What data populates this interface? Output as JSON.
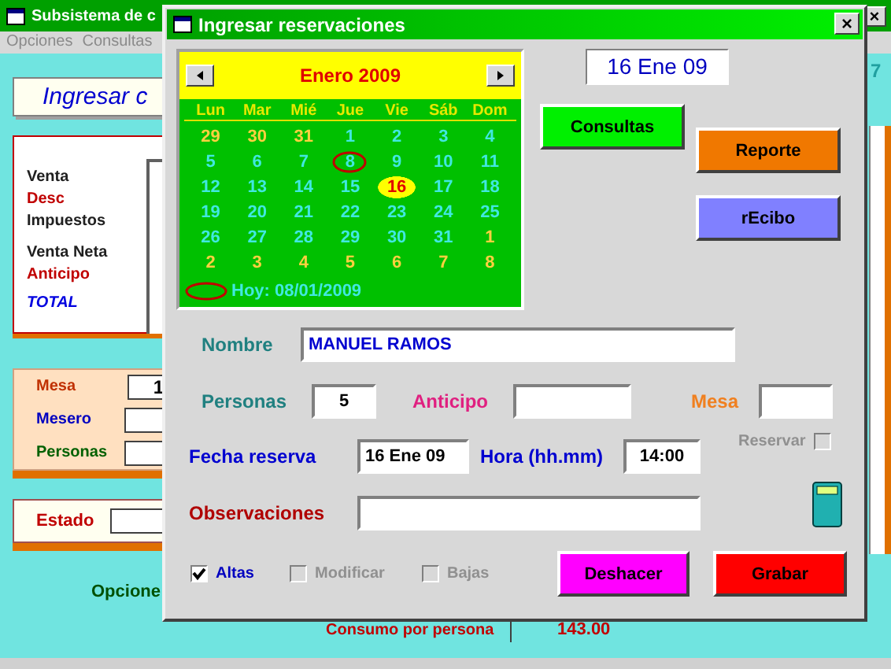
{
  "main_window": {
    "title": "Subsistema de c",
    "close_button": "×",
    "menu": [
      {
        "label": "Opciones",
        "disabled": true
      },
      {
        "label": "Consultas",
        "disabled": true
      }
    ],
    "header_field": {
      "value": "Ingresar c"
    },
    "right_text": "7",
    "totals": [
      {
        "label": "Venta",
        "color": "#202020"
      },
      {
        "label": "Desc",
        "color": "#c00000"
      },
      {
        "label": "Impuestos",
        "color": "#202020"
      },
      {
        "label": "Venta Neta",
        "color": "#202020"
      },
      {
        "label": "Anticipo",
        "color": "#c00000"
      },
      {
        "label": "TOTAL",
        "color": "#0000e0"
      }
    ],
    "table_panel": [
      {
        "label": "Mesa",
        "value": "1",
        "color": "#c03000"
      },
      {
        "label": "Mesero",
        "color": "#0000c0"
      },
      {
        "label": "Personas",
        "color": "#006000"
      }
    ],
    "status_label": "Estado",
    "options_label": "Opcione",
    "per_person": {
      "label": "Consumo por persona",
      "value": "143.00"
    }
  },
  "dialog": {
    "title": "Ingresar reservaciones",
    "close_button": "×",
    "calendar": {
      "month": "Enero 2009",
      "weekdays": [
        "Lun",
        "Mar",
        "Mié",
        "Jue",
        "Vie",
        "Sáb",
        "Dom"
      ],
      "weeks": [
        [
          {
            "day": "29",
            "other_month": true,
            "selected": false,
            "today": false
          },
          {
            "day": "30",
            "other_month": true,
            "selected": false,
            "today": false
          },
          {
            "day": "31",
            "other_month": true,
            "selected": false,
            "today": false
          },
          {
            "day": "1",
            "other_month": false,
            "selected": false,
            "today": false
          },
          {
            "day": "2",
            "other_month": false,
            "selected": false,
            "today": false
          },
          {
            "day": "3",
            "other_month": false,
            "selected": false,
            "today": false
          },
          {
            "day": "4",
            "other_month": false,
            "selected": false,
            "today": false
          }
        ],
        [
          {
            "day": "5",
            "other_month": false,
            "selected": false,
            "today": false
          },
          {
            "day": "6",
            "other_month": false,
            "selected": false,
            "today": false
          },
          {
            "day": "7",
            "other_month": false,
            "selected": false,
            "today": false
          },
          {
            "day": "8",
            "other_month": false,
            "selected": false,
            "today": true
          },
          {
            "day": "9",
            "other_month": false,
            "selected": false,
            "today": false
          },
          {
            "day": "10",
            "other_month": false,
            "selected": false,
            "today": false
          },
          {
            "day": "11",
            "other_month": false,
            "selected": false,
            "today": false
          }
        ],
        [
          {
            "day": "12",
            "other_month": false,
            "selected": false,
            "today": false
          },
          {
            "day": "13",
            "other_month": false,
            "selected": false,
            "today": false
          },
          {
            "day": "14",
            "other_month": false,
            "selected": false,
            "today": false
          },
          {
            "day": "15",
            "other_month": false,
            "selected": false,
            "today": false
          },
          {
            "day": "16",
            "other_month": false,
            "selected": true,
            "today": false
          },
          {
            "day": "17",
            "other_month": false,
            "selected": false,
            "today": false
          },
          {
            "day": "18",
            "other_month": false,
            "selected": false,
            "today": false
          }
        ],
        [
          {
            "day": "19",
            "other_month": false,
            "selected": false,
            "today": false
          },
          {
            "day": "20",
            "other_month": false,
            "selected": false,
            "today": false
          },
          {
            "day": "21",
            "other_month": false,
            "selected": false,
            "today": false
          },
          {
            "day": "22",
            "other_month": false,
            "selected": false,
            "today": false
          },
          {
            "day": "23",
            "other_month": false,
            "selected": false,
            "today": false
          },
          {
            "day": "24",
            "other_month": false,
            "selected": false,
            "today": false
          },
          {
            "day": "25",
            "other_month": false,
            "selected": false,
            "today": false
          }
        ],
        [
          {
            "day": "26",
            "other_month": false,
            "selected": false,
            "today": false
          },
          {
            "day": "27",
            "other_month": false,
            "selected": false,
            "today": false
          },
          {
            "day": "28",
            "other_month": false,
            "selected": false,
            "today": false
          },
          {
            "day": "29",
            "other_month": false,
            "selected": false,
            "today": false
          },
          {
            "day": "30",
            "other_month": false,
            "selected": false,
            "today": false
          },
          {
            "day": "31",
            "other_month": false,
            "selected": false,
            "today": false
          },
          {
            "day": "1",
            "other_month": true,
            "selected": false,
            "today": false
          }
        ],
        [
          {
            "day": "2",
            "other_month": true,
            "selected": false,
            "today": false
          },
          {
            "day": "3",
            "other_month": true,
            "selected": false,
            "today": false
          },
          {
            "day": "4",
            "other_month": true,
            "selected": false,
            "today": false
          },
          {
            "day": "5",
            "other_month": true,
            "selected": false,
            "today": false
          },
          {
            "day": "6",
            "other_month": true,
            "selected": false,
            "today": false
          },
          {
            "day": "7",
            "other_month": true,
            "selected": false,
            "today": false
          },
          {
            "day": "8",
            "other_month": true,
            "selected": false,
            "today": false
          }
        ]
      ],
      "today_label": "Hoy: 08/01/2009"
    },
    "date_field": {
      "value": "16 Ene 09"
    },
    "buttons": [
      {
        "label": "Consultas",
        "kind": "consult"
      },
      {
        "label": "Reporte",
        "kind": "report"
      },
      {
        "label": "rEcibo",
        "kind": "receipt"
      }
    ],
    "fields": {
      "nombre": {
        "label": "Nombre",
        "value": "MANUEL RAMOS"
      },
      "personas": {
        "label": "Personas",
        "value": "5"
      },
      "anticipo": {
        "label": "Anticipo"
      },
      "mesa": {
        "label": "Mesa"
      },
      "fecha": {
        "label": "Fecha reserva",
        "value": "16 Ene 09"
      },
      "hora": {
        "label": "Hora (hh.mm)",
        "value": "14:00"
      },
      "reservar": {
        "label": "Reservar",
        "checked": false,
        "disabled": true
      },
      "observaciones": {
        "label": "Observaciones"
      }
    },
    "modes": [
      {
        "label": "Altas",
        "checked": true,
        "disabled": false
      },
      {
        "label": "Modificar",
        "checked": false,
        "disabled": true
      },
      {
        "label": "Bajas",
        "checked": false,
        "disabled": true
      }
    ],
    "actions": [
      {
        "label": "Deshacer",
        "kind": "undo"
      },
      {
        "label": "Grabar",
        "kind": "save"
      }
    ]
  }
}
